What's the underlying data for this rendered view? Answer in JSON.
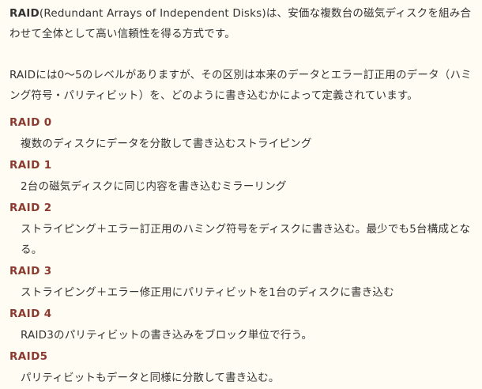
{
  "intro": {
    "p1_term": "RAID",
    "p1_text": "(Redundant Arrays of Independent Disks)は、安価な複数台の磁気ディスクを組み合わせて全体として高い信頼性を得る方式です。",
    "p2_text": "RAIDには0〜5のレベルがありますが、その区別は本来のデータとエラー訂正用のデータ（ハミング符号・パリティビット）を、どのように書き込むかによって定義されています。"
  },
  "levels": [
    {
      "term": "RAID 0",
      "desc": "複数のディスクにデータを分散して書き込むストライピング"
    },
    {
      "term": "RAID 1",
      "desc": "2台の磁気ディスクに同じ内容を書き込むミラーリング"
    },
    {
      "term": "RAID 2",
      "desc": "ストライピング＋エラー訂正用のハミング符号をディスクに書き込む。最少でも5台構成となる。"
    },
    {
      "term": "RAID 3",
      "desc": "ストライピング＋エラー修正用にパリティビットを1台のディスクに書き込む"
    },
    {
      "term": "RAID 4",
      "desc": "RAID3のパリティビットの書き込みをブロック単位で行う。"
    },
    {
      "term": "RAID5",
      "desc": "パリティビットもデータと同様に分散して書き込む。"
    }
  ],
  "colors": {
    "background": "#fefcf3",
    "text": "#333333",
    "term": "#8b3a2f"
  }
}
